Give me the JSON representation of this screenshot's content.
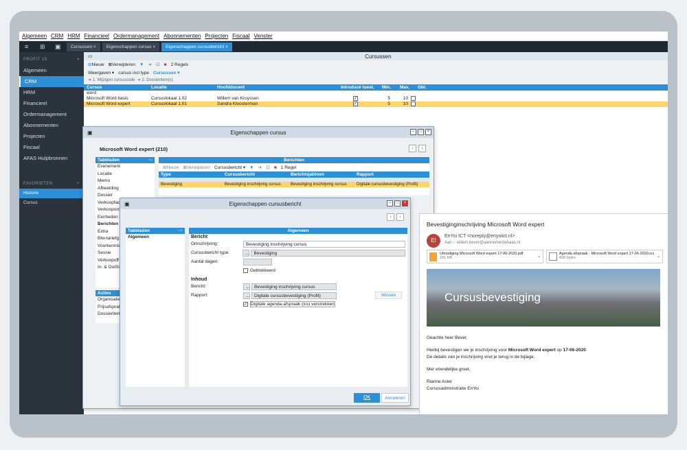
{
  "menu": [
    "Algemeen",
    "CRM",
    "HRM",
    "Financieel",
    "Ordermanagement",
    "Abonnementen",
    "Projecten",
    "Fiscaal",
    "Venster"
  ],
  "tabs": [
    {
      "label": "Cursussen",
      "active": false
    },
    {
      "label": "Eigenschappen cursus",
      "active": false
    },
    {
      "label": "Eigenschappen cursusbericht",
      "active": true
    }
  ],
  "sidebar": {
    "heading": "PROFIT 15",
    "items": [
      "Algemeen",
      "CRM",
      "HRM",
      "Financieel",
      "Ordermanagement",
      "Abonnementen",
      "Projecten",
      "Fiscaal",
      "AFAS Hulpbronnen"
    ],
    "active": "CRM",
    "favorites_heading": "FAVORIETEN",
    "favorites": [
      "Historie",
      "Cursus"
    ]
  },
  "cursussen": {
    "title": "Cursussen",
    "toolbar": {
      "new": "Nieuw",
      "delete": "Verwijderen",
      "count": "2 Regels",
      "views": "Weergaven",
      "filter": "cursus incl type",
      "group": "Cursussen"
    },
    "crumbs": [
      "1. Wijzigen cursuscode",
      "2. Dossieritem(s)"
    ],
    "columns": [
      "Cursus",
      "Locatie",
      "Hoofddocent",
      "Introducé toest.",
      "Min.",
      "Max.",
      "Gbl."
    ],
    "filter_value": "word",
    "rows": [
      {
        "cursus": "Microsoft Word basis",
        "locatie": "Cursuslokaal 1.02",
        "docent": "Willem van Kruyssen",
        "min": "5",
        "max": "10",
        "selected": false
      },
      {
        "cursus": "Microsoft Word expert",
        "locatie": "Cursuslokaal 1.01",
        "docent": "Sandra Kloosterman",
        "min": "5",
        "max": "10",
        "selected": true
      }
    ]
  },
  "cursus_window": {
    "title": "Eigenschappen cursus",
    "subject": "Microsoft Word expert (210)",
    "tabs_heading": "Tabbladen",
    "tabs": [
      "Evenement",
      "Locatie",
      "Memo",
      "Afbeelding",
      "Dossier",
      "Verkoopfac",
      "Verkoopord",
      "Eenheden p",
      "Berichten",
      "Extra",
      "Btw-tariefg",
      "Voorkennis",
      "Sessie",
      "Verkoopoff",
      "In- & OutSi"
    ],
    "actions_heading": "Acties",
    "actions": [
      "Organisatie",
      "Prijsafsprak",
      "Dossieritem"
    ],
    "berichten": {
      "heading": "Berichten",
      "toolbar": {
        "new": "Nieuw",
        "delete": "Verwijderen",
        "type": "Cursusbericht",
        "count": "1 Regel"
      },
      "columns": [
        "Type",
        "Cursusbericht",
        "Berichtsjabloon",
        "Rapport"
      ],
      "row": {
        "type": "Bevestiging",
        "bericht": "Bevestiging inschrijving cursus",
        "sjabloon": "Bevestiging inschrijving cursus",
        "rapport": "Digitale cursusbevestiging (Profit)"
      }
    }
  },
  "bericht_window": {
    "title": "Eigenschappen cursusbericht",
    "tabs_heading": "Tabbladen",
    "tab": "Algemeen",
    "section": "Algemeen",
    "bericht_label": "Bericht",
    "fields": {
      "omschrijving_label": "Omschrijving:",
      "omschrijving_value": "Bevestiging inschrijving cursus",
      "type_label": "Cursusbericht type:",
      "type_value": "Bevestiging",
      "dagen_label": "Aantal dagen:",
      "geblokkeerd": "Geblokkeerd"
    },
    "inhoud_label": "Inhoud",
    "inhoud": {
      "bericht_label": "Bericht:",
      "bericht_value": "Bevestiging inschrijving cursus",
      "rapport_label": "Rapport:",
      "rapport_value": "Digitale cursusbevestiging (Profit)",
      "wissen": "Wissen",
      "verstrekken": "Digitale agenda-afspraak (ics) verstrekken"
    },
    "ok": "OK",
    "cancel": "Annuleren"
  },
  "email": {
    "subject": "Bevestiginginschrijving Microsoft Word expert",
    "avatar": "EI",
    "from": "EnYoi ICT <noreply@enyoiict.nl>",
    "to_label": "Aan",
    "to": "willem.bever@aannemerdehaas.nl",
    "attachments": [
      {
        "name": "Uitnodiging Microsoft Word expert 17-06-2020.pdf",
        "size": "181 KB"
      },
      {
        "name": "Agenda afspraak - Microsoft Word expert 17-06-2020.ics",
        "size": "438 bytes"
      }
    ],
    "hero": "Cursusbevestiging",
    "greeting": "Geachte heer Bever,",
    "line1_a": "Hierbij bevestigen we je inschrijving voor ",
    "line1_b": "Microsoft Word expert",
    "line1_c": " op ",
    "line1_d": "17-06-2020",
    "line1_e": ".",
    "line2": "De details van je inschrijving vind je terug in de bijlage.",
    "closing": "Met vriendelijke groet,",
    "signer": "Rianne Aster",
    "signer_role": "Cursusadministratie EnYoi"
  }
}
